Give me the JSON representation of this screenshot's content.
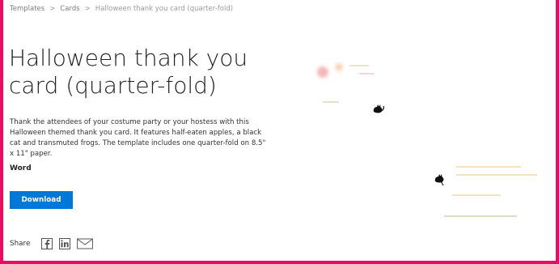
{
  "breadcrumb": {
    "items": [
      {
        "label": "Templates"
      },
      {
        "label": "Cards"
      },
      {
        "label": "Halloween thank you card (quarter-fold)"
      }
    ],
    "separator": ">"
  },
  "template": {
    "title": "Halloween thank you card (quarter-fold)",
    "description": "Thank the attendees of your costume party or your hostess with this Halloween themed thank you card. It features half-eaten apples, a black cat and transmuted frogs. The template includes one quarter-fold on 8.5\" x 11\" paper.",
    "app": "Word",
    "download_label": "Download"
  },
  "share": {
    "label": "Share",
    "icons": [
      "facebook-icon",
      "linkedin-icon",
      "email-icon"
    ]
  },
  "colors": {
    "border": "#e60d63",
    "accent": "#0078d7"
  }
}
